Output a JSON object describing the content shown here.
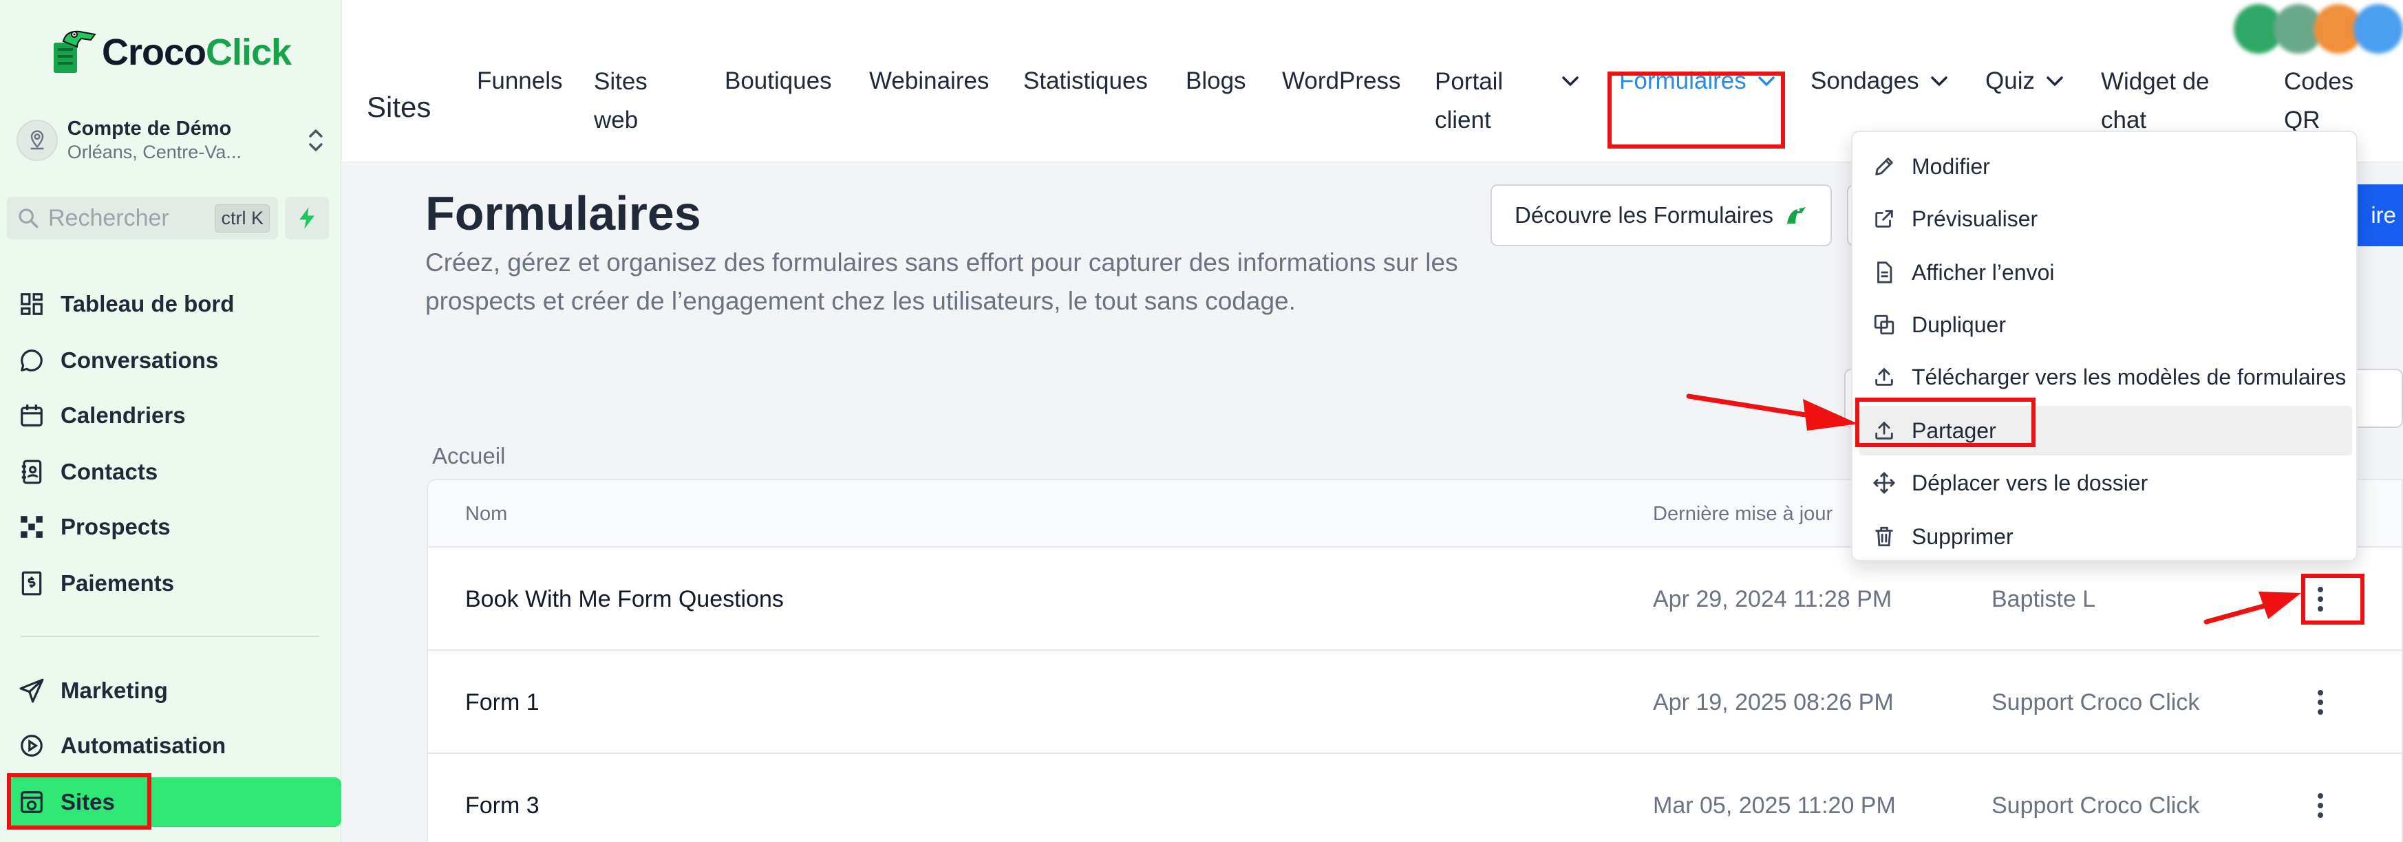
{
  "brand": {
    "part1": "Croco",
    "part2": "Click"
  },
  "account": {
    "name": "Compte de Démo",
    "location": "Orléans, Centre-Va..."
  },
  "search": {
    "placeholder": "Rechercher",
    "shortcut": "ctrl K"
  },
  "sidebar": {
    "items": [
      {
        "label": "Tableau de bord",
        "icon": "dashboard-icon"
      },
      {
        "label": "Conversations",
        "icon": "chat-bubble-icon"
      },
      {
        "label": "Calendriers",
        "icon": "calendar-icon"
      },
      {
        "label": "Contacts",
        "icon": "contacts-book-icon"
      },
      {
        "label": "Prospects",
        "icon": "pipeline-icon"
      },
      {
        "label": "Paiements",
        "icon": "payment-icon"
      },
      {
        "label": "Marketing",
        "icon": "send-icon"
      },
      {
        "label": "Automatisation",
        "icon": "automation-icon"
      },
      {
        "label": "Sites",
        "icon": "sites-icon"
      }
    ],
    "active": "Sites"
  },
  "topnav": {
    "title": "Sites",
    "items": [
      {
        "label": "Funnels"
      },
      {
        "label_line1": "Sites",
        "label_line2": "web"
      },
      {
        "label": "Boutiques"
      },
      {
        "label": "Webinaires"
      },
      {
        "label": "Statistiques"
      },
      {
        "label": "Blogs"
      },
      {
        "label": "WordPress"
      },
      {
        "label_line1": "Portail",
        "label_line2": "client"
      },
      {
        "label": "Formulaires",
        "active": true
      },
      {
        "label": "Sondages"
      },
      {
        "label": "Quiz"
      },
      {
        "label_line1": "Widget de",
        "label_line2": "chat"
      },
      {
        "label_line1": "Codes",
        "label_line2": "QR"
      }
    ]
  },
  "page": {
    "title": "Formulaires",
    "description": "Créez, gérez et organisez des formulaires sans effort pour capturer des informations sur les prospects et créer de l’engagement chez les utilisateurs, le tout sans codage.",
    "discover_button": "Découvre les Formulaires",
    "new_button": "ire",
    "breadcrumb": "Accueil"
  },
  "table": {
    "columns": [
      "Nom",
      "Dernière mise à jour"
    ],
    "rows": [
      {
        "name": "Book With Me Form Questions",
        "updated": "Apr 29, 2024 11:28 PM",
        "user": "Baptiste L"
      },
      {
        "name": "Form 1",
        "updated": "Apr 19, 2025 08:26 PM",
        "user": "Support Croco Click"
      },
      {
        "name": "Form 3",
        "updated": "Mar 05, 2025 11:20 PM",
        "user": "Support Croco Click"
      }
    ]
  },
  "menu": {
    "items": [
      {
        "label": "Modifier",
        "icon": "pencil-icon"
      },
      {
        "label": "Prévisualiser",
        "icon": "external-link-icon"
      },
      {
        "label": "Afficher l’envoi",
        "icon": "document-icon"
      },
      {
        "label": "Dupliquer",
        "icon": "copy-icon"
      },
      {
        "label": "Télécharger vers les modèles de formulaires",
        "icon": "upload-icon"
      },
      {
        "label": "Partager",
        "icon": "share-icon",
        "highlighted": true
      },
      {
        "label": "Déplacer vers le dossier",
        "icon": "move-icon"
      },
      {
        "label": "Supprimer",
        "icon": "trash-icon"
      }
    ]
  },
  "colors": {
    "accent_green": "#2ee774",
    "brand_green": "#16a34a",
    "primary_blue": "#155eef",
    "active_tab_blue": "#2a8ae4",
    "annotation_red": "#ef1111"
  }
}
